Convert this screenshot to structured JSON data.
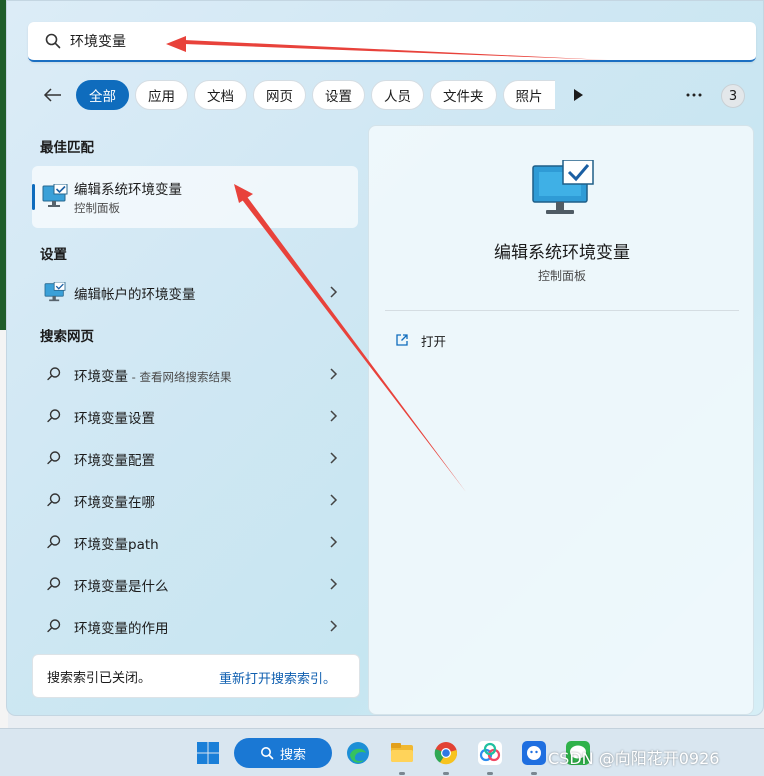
{
  "search": {
    "value": "环境变量"
  },
  "filters": [
    "全部",
    "应用",
    "文档",
    "网页",
    "设置",
    "人员",
    "文件夹",
    "照片"
  ],
  "result_count": "3",
  "sections": {
    "best_match": "最佳匹配",
    "settings": "设置",
    "web": "搜索网页"
  },
  "best_match": {
    "title": "编辑系统环境变量",
    "subtitle": "控制面板"
  },
  "settings_item": "编辑帐户的环境变量",
  "web_items": [
    {
      "label": "环境变量",
      "suffix": " - 查看网络搜索结果"
    },
    {
      "label": "环境变量设置",
      "suffix": ""
    },
    {
      "label": "环境变量配置",
      "suffix": ""
    },
    {
      "label": "环境变量在哪",
      "suffix": ""
    },
    {
      "label": "环境变量path",
      "suffix": ""
    },
    {
      "label": "环境变量是什么",
      "suffix": ""
    },
    {
      "label": "环境变量的作用",
      "suffix": ""
    }
  ],
  "index_notice": {
    "message": "搜索索引已关闭。",
    "link": "重新打开搜索索引。"
  },
  "detail": {
    "title": "编辑系统环境变量",
    "subtitle": "控制面板",
    "action": "打开"
  },
  "taskbar": {
    "search_label": "搜索"
  },
  "watermark": "CSDN @向阳花开0926",
  "colors": {
    "accent": "#0f6cbd",
    "annotation_arrow": "#e8423b"
  }
}
